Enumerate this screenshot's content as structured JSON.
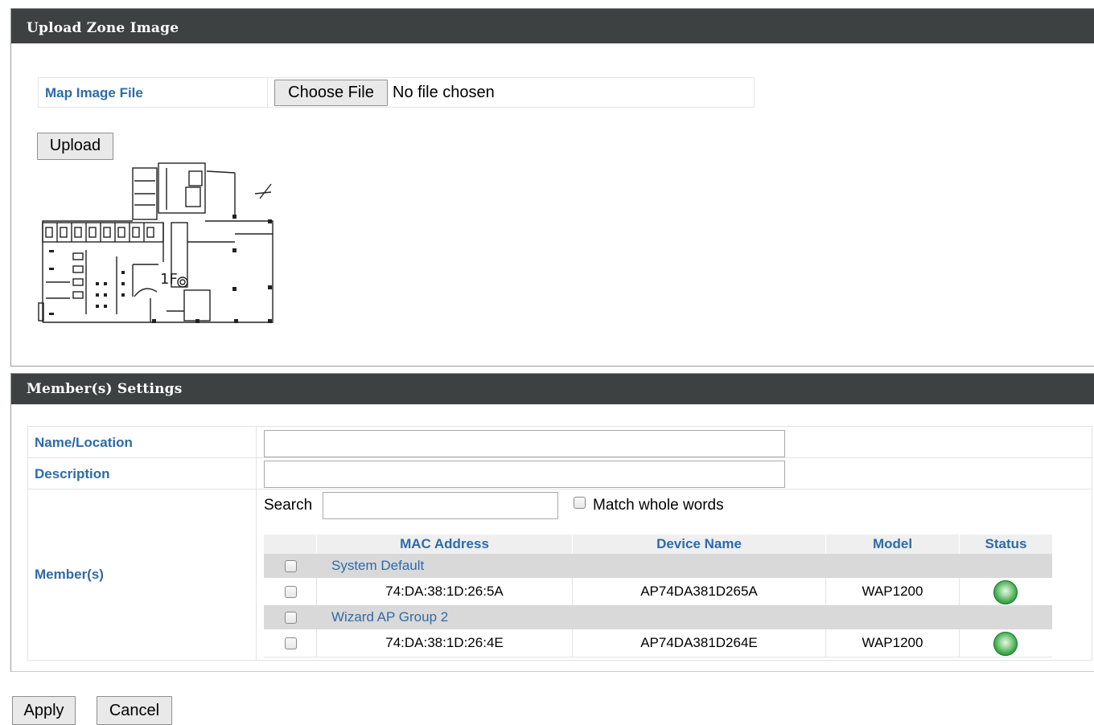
{
  "upload_section": {
    "title": "Upload Zone Image",
    "map_image_label": "Map Image File",
    "choose_file_label": "Choose File",
    "no_file_text": "No file chosen",
    "upload_label": "Upload",
    "floor_plan_label": "1F"
  },
  "members_section": {
    "title": "Member(s) Settings",
    "name_label": "Name/Location",
    "name_value": "",
    "description_label": "Description",
    "description_value": "",
    "members_label": "Member(s)",
    "search_label": "Search",
    "search_value": "",
    "match_whole_words_label": "Match whole words",
    "match_whole_words_checked": false,
    "columns": [
      "MAC Address",
      "Device Name",
      "Model",
      "Status"
    ],
    "groups": [
      {
        "name": "System Default",
        "checked": false,
        "devices": [
          {
            "mac": "74:DA:38:1D:26:5A",
            "device_name": "AP74DA381D265A",
            "model": "WAP1200",
            "status": "online",
            "checked": false
          }
        ]
      },
      {
        "name": "Wizard AP Group 2",
        "checked": false,
        "devices": [
          {
            "mac": "74:DA:38:1D:26:4E",
            "device_name": "AP74DA381D264E",
            "model": "WAP1200",
            "status": "online",
            "checked": false
          }
        ]
      }
    ]
  },
  "footer": {
    "apply_label": "Apply",
    "cancel_label": "Cancel"
  },
  "colors": {
    "header_bg": "#3e4142",
    "label_blue": "#2f6aa8",
    "group_row_bg": "#d9d9d9",
    "status_online": "#2e9e3e"
  }
}
